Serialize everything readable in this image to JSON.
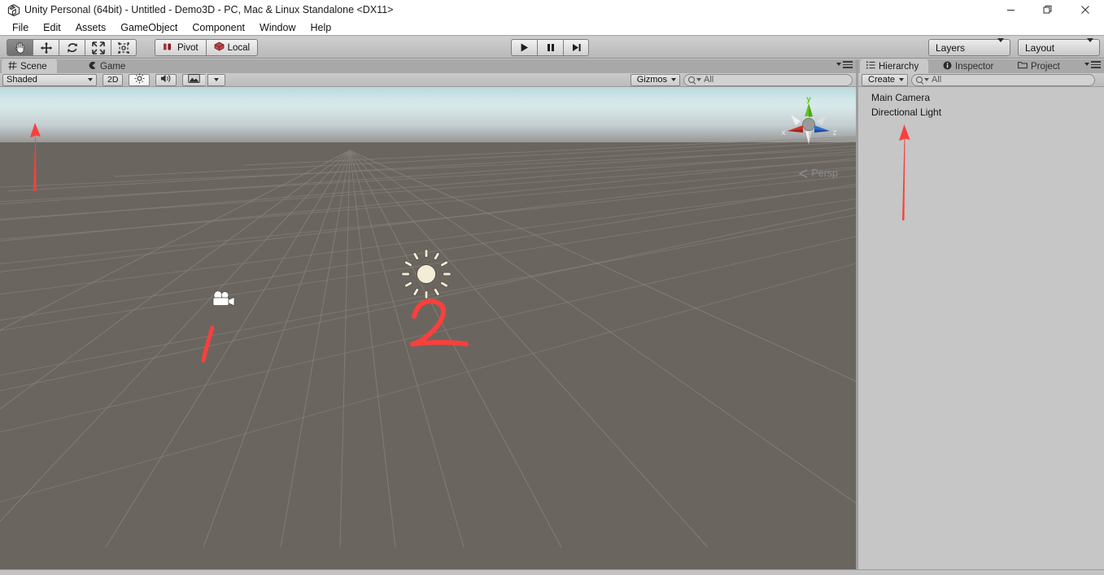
{
  "window": {
    "title": "Unity Personal (64bit) - Untitled - Demo3D - PC, Mac & Linux Standalone <DX11>",
    "logo_icon": "unity-logo-icon",
    "minimize_label": "—",
    "maximize_label": "❐",
    "close_label": "✕"
  },
  "menubar": {
    "items": [
      {
        "label": "File"
      },
      {
        "label": "Edit"
      },
      {
        "label": "Assets"
      },
      {
        "label": "GameObject"
      },
      {
        "label": "Component"
      },
      {
        "label": "Window"
      },
      {
        "label": "Help"
      }
    ]
  },
  "toolbar": {
    "transform_tools": [
      {
        "name": "hand-tool",
        "icon": "hand-icon",
        "active": true
      },
      {
        "name": "move-tool",
        "icon": "move-arrows-icon",
        "active": false
      },
      {
        "name": "rotate-tool",
        "icon": "rotate-icon",
        "active": false
      },
      {
        "name": "scale-tool",
        "icon": "scale-icon",
        "active": false
      },
      {
        "name": "rect-tool",
        "icon": "rect-transform-icon",
        "active": false
      }
    ],
    "pivot_label": "Pivot",
    "pivot_icon": "pivot-icon",
    "local_label": "Local",
    "local_icon": "local-axis-icon",
    "play_label": "▶",
    "pause_label": "⏸",
    "step_label": "⏭",
    "layers_label": "Layers",
    "layout_label": "Layout"
  },
  "scene_panel": {
    "tabs": [
      {
        "label": "Scene",
        "icon": "scene-grid-icon",
        "active": true
      },
      {
        "label": "Game",
        "icon": "game-pacman-icon",
        "active": false
      }
    ],
    "draw_mode": "Shaded",
    "view_2d_label": "2D",
    "lighting_icon": "sun-lighting-icon",
    "audio_icon": "speaker-audio-icon",
    "effects_icon": "image-effects-icon",
    "gizmos_label": "Gizmos",
    "search_value": "All",
    "search_placeholder": "All",
    "search_icon": "search-icon",
    "options_icon": "panel-options-icon",
    "persp_label": "Persp",
    "axis_labels": {
      "x": "x",
      "y": "y",
      "z": "z"
    },
    "axis_colors": {
      "x": "#c8352c",
      "y": "#63c723",
      "z": "#2d6fd8",
      "center": "#8c8c8c",
      "neutral": "#e6e6e6"
    },
    "scene_objects": [
      {
        "name": "directional-light-gizmo",
        "icon": "sun-icon"
      },
      {
        "name": "main-camera-gizmo",
        "icon": "camera-icon"
      }
    ],
    "annotations": [
      {
        "name": "annotation-number-1",
        "text": "1",
        "color": "#f8403c"
      },
      {
        "name": "annotation-number-2",
        "text": "2",
        "color": "#f8403c"
      },
      {
        "name": "annotation-arrow-scene",
        "text": "arrow-up",
        "color": "#f8403c"
      }
    ],
    "colors": {
      "ground": "#6b6560",
      "grid_line": "#857f79",
      "sky_top": "#b9d9dd",
      "sky_bottom": "#7d7671"
    }
  },
  "right_panel": {
    "tabs": [
      {
        "label": "Hierarchy",
        "icon": "hierarchy-list-icon",
        "active": true
      },
      {
        "label": "Inspector",
        "icon": "info-circle-icon",
        "active": false
      },
      {
        "label": "Project",
        "icon": "folder-icon",
        "active": false
      }
    ],
    "create_label": "Create",
    "search_value": "All",
    "search_placeholder": "All",
    "search_icon": "search-icon",
    "options_icon": "panel-options-icon",
    "hierarchy_items": [
      {
        "label": "Main Camera"
      },
      {
        "label": "Directional Light"
      }
    ],
    "annotations": [
      {
        "name": "annotation-arrow-hierarchy",
        "text": "arrow-up",
        "color": "#f8403c"
      }
    ]
  }
}
